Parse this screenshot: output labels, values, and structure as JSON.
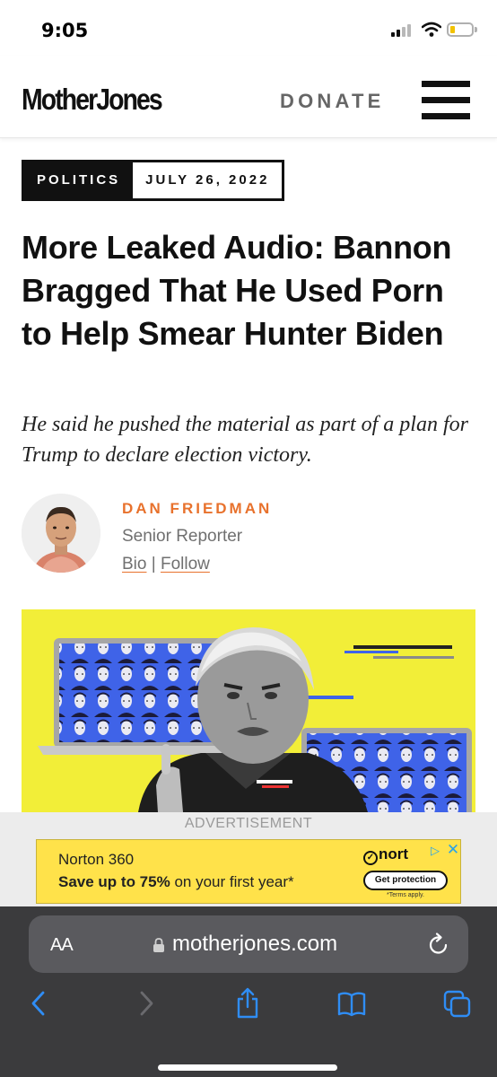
{
  "status_bar": {
    "time": "9:05"
  },
  "header": {
    "logo": "MotherJones",
    "donate_label": "DONATE"
  },
  "article": {
    "section": "POLITICS",
    "date": "JULY 26, 2022",
    "headline": "More Leaked Audio: Bannon Bragged That He Used Porn to Help Smear Hunter Biden",
    "dek": "He said he pushed the material as part of a plan for Trump to declare election victory.",
    "author": {
      "name": "DAN FRIEDMAN",
      "title": "Senior Reporter",
      "bio_link": "Bio",
      "separator": "|",
      "follow_link": "Follow"
    }
  },
  "ad": {
    "label": "ADVERTISEMENT",
    "brand": "Norton 360",
    "offer_bold": "Save up to 75%",
    "offer_rest": " on your first year*",
    "logo_text": "nort",
    "cta": "Get protection",
    "terms": "*Terms apply."
  },
  "browser": {
    "text_size_label": "AA",
    "url": "motherjones.com"
  },
  "colors": {
    "accent_orange": "#e8722d",
    "hero_yellow": "#f2ee38",
    "ad_yellow": "#ffe24a",
    "browser_chrome": "#3b3b3d",
    "ios_blue": "#2f8df5"
  },
  "icons": [
    "signal-icon",
    "wifi-icon",
    "battery-icon",
    "menu-icon",
    "lock-icon",
    "reload-icon",
    "back-icon",
    "forward-icon",
    "share-icon",
    "bookmarks-icon",
    "tabs-icon",
    "adchoices-icon",
    "close-ad-icon"
  ]
}
